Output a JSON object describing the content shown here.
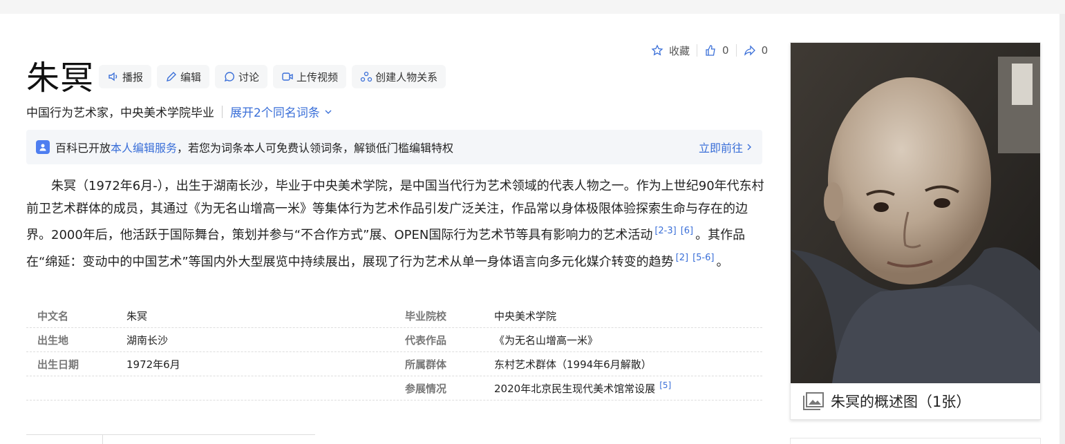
{
  "entry": {
    "title": "朱冥",
    "subtitle": "中国行为艺术家，中央美术学院毕业",
    "expand_label": "展开2个同名词条"
  },
  "tools": [
    {
      "label": "播报",
      "icon": "speaker-icon"
    },
    {
      "label": "编辑",
      "icon": "pencil-icon"
    },
    {
      "label": "讨论",
      "icon": "chat-bubble-icon"
    },
    {
      "label": "上传视频",
      "icon": "video-icon"
    },
    {
      "label": "创建人物关系",
      "icon": "people-relation-icon"
    }
  ],
  "actions": {
    "favorite_label": "收藏",
    "like_count": "0",
    "share_count": "0"
  },
  "notice": {
    "prefix": "百科已开放",
    "link": "本人编辑服务",
    "suffix": "，若您为词条本人可免费认领词条，解锁低门槛编辑特权",
    "go_label": "立即前往"
  },
  "summary": {
    "p1": "朱冥（1972年6月-），出生于湖南长沙，毕业于中央美术学院，是中国当代行为艺术领域的代表人物之一。作为上世纪90年代东村前卫艺术群体的成员，其通过《为无名山增高一米》等集体行为艺术作品引发广泛关注，作品常以身体极限体验探索生命与存在的边界。2000年后，他活跃于国际舞台，策划并参与“不合作方式”展、OPEN国际行为艺术节等具有影响力的艺术活动",
    "ref1": "[2-3]",
    "ref2": "[6]",
    "p2": "。其作品在“绵延：变动中的中国艺术”等国内外大型展览中持续展出，展现了行为艺术从单一身体语言向多元化媒介转变的趋势",
    "ref3": "[2]",
    "ref4": "[5-6]",
    "p3": "。"
  },
  "info": [
    {
      "k1": "中文名",
      "v1": "朱冥",
      "k2": "毕业院校",
      "v2": "中央美术学院"
    },
    {
      "k1": "出生地",
      "v1": "湖南长沙",
      "k2": "代表作品",
      "v2": "《为无名山增高一米》"
    },
    {
      "k1": "出生日期",
      "v1": "1972年6月",
      "k2": "所属群体",
      "v2": "东村艺术群体（1994年6月解散）"
    },
    {
      "k1": "",
      "v1": "",
      "k2": "参展情况",
      "v2": "2020年北京民生现代美术馆常设展",
      "ref": "[5]"
    }
  ],
  "album": {
    "caption": "朱冥的概述图（1张）"
  }
}
